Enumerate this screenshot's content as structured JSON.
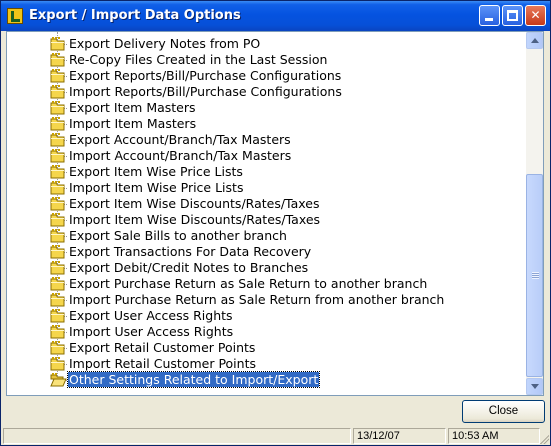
{
  "window": {
    "title": "Export / Import Data Options",
    "controls": {
      "minimize": "minimize-icon",
      "maximize": "maximize-icon",
      "close": "✕"
    }
  },
  "list": {
    "items": [
      {
        "label": "Export Delivery Notes from PO",
        "icon": "folder-icon"
      },
      {
        "label": "Re-Copy Files Created in the Last Session",
        "icon": "folder-icon"
      },
      {
        "label": "Export Reports/Bill/Purchase Configurations",
        "icon": "folder-icon"
      },
      {
        "label": "Import Reports/Bill/Purchase Configurations",
        "icon": "folder-icon"
      },
      {
        "label": "Export Item Masters",
        "icon": "folder-icon"
      },
      {
        "label": "Import Item Masters",
        "icon": "folder-icon"
      },
      {
        "label": "Export Account/Branch/Tax Masters",
        "icon": "folder-icon"
      },
      {
        "label": "Import Account/Branch/Tax Masters",
        "icon": "folder-icon"
      },
      {
        "label": "Export Item Wise Price Lists",
        "icon": "folder-icon"
      },
      {
        "label": "Import Item Wise Price Lists",
        "icon": "folder-icon"
      },
      {
        "label": "Export Item Wise Discounts/Rates/Taxes",
        "icon": "folder-icon"
      },
      {
        "label": "Import Item Wise Discounts/Rates/Taxes",
        "icon": "folder-icon"
      },
      {
        "label": "Export Sale Bills to another branch",
        "icon": "folder-icon"
      },
      {
        "label": "Export Transactions For Data Recovery",
        "icon": "folder-icon"
      },
      {
        "label": "Export Debit/Credit Notes to Branches",
        "icon": "folder-icon"
      },
      {
        "label": "Export Purchase Return as Sale Return to another branch",
        "icon": "folder-icon"
      },
      {
        "label": "Import Purchase Return as Sale Return from another branch",
        "icon": "folder-icon"
      },
      {
        "label": "Export User Access Rights",
        "icon": "folder-icon"
      },
      {
        "label": "Import User Access Rights",
        "icon": "folder-icon"
      },
      {
        "label": "Export Retail Customer Points",
        "icon": "folder-icon"
      },
      {
        "label": "Import Retail Customer Points",
        "icon": "folder-icon"
      },
      {
        "label": "Other Settings Related to Import/Export",
        "icon": "open-folder-icon",
        "selected": true
      }
    ]
  },
  "buttons": {
    "close_label": "Close"
  },
  "status": {
    "panel1": "",
    "date": "13/12/07",
    "time": "10:53 AM"
  },
  "colors": {
    "titlebar": "#0553e0",
    "selection": "#316ac5",
    "folder": "#f5d64c"
  }
}
